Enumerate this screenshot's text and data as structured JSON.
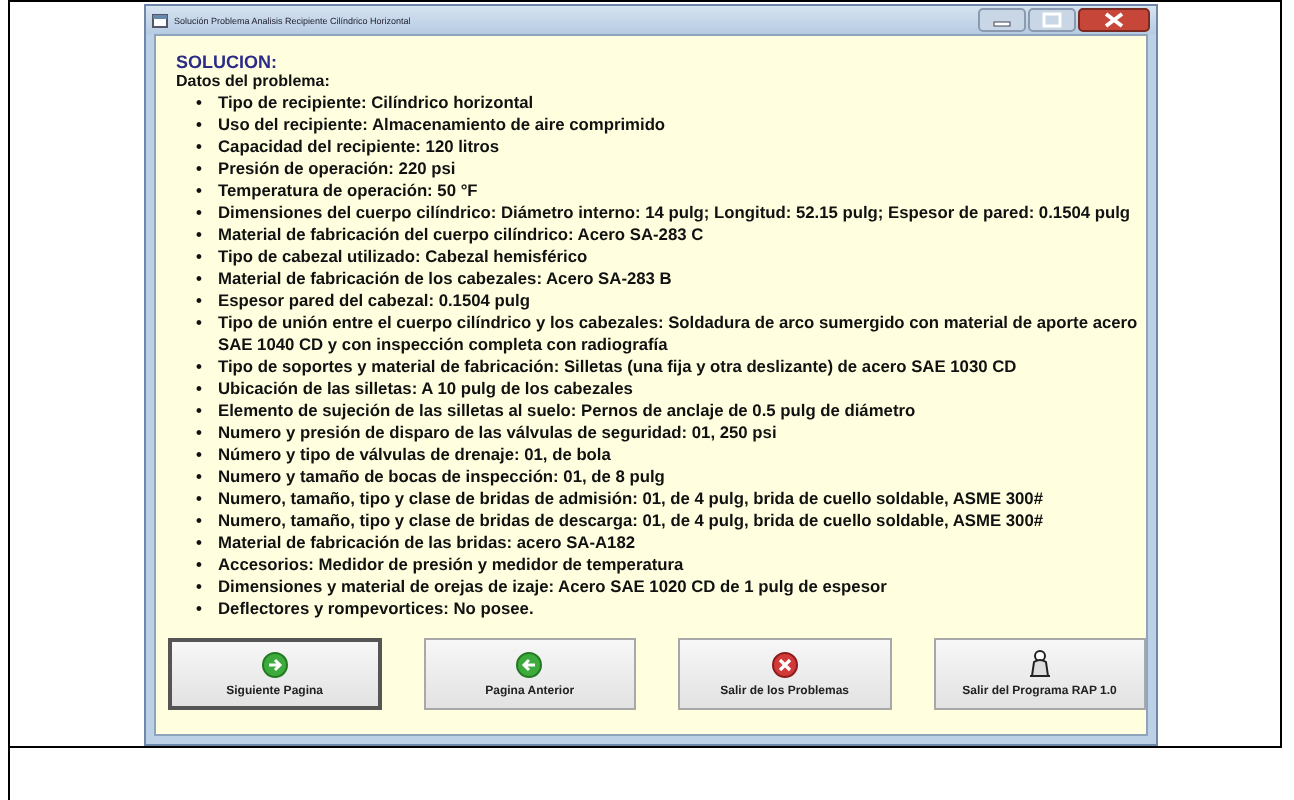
{
  "window": {
    "title": "Solución Problema Analisis Recipiente Cilíndrico Horizontal"
  },
  "heading": "SOLUCION:",
  "subheading": "Datos del problema:",
  "items": [
    {
      "bullet": "•",
      "text": "Tipo de recipiente: Cilíndrico horizontal"
    },
    {
      "bullet": "•",
      "text": "Uso del recipiente: Almacenamiento de aire comprimido"
    },
    {
      "bullet": "•",
      "text": "Capacidad del recipiente: 120 litros"
    },
    {
      "bullet": "•",
      "text": "Presión de operación: 220 psi"
    },
    {
      "bullet": "•",
      "text": "Temperatura de operación: 50 °F"
    },
    {
      "bullet": "•",
      "text": "Dimensiones del cuerpo cilíndrico: Diámetro interno: 14 pulg; Longitud: 52.15 pulg; Espesor de pared: 0.1504 pulg"
    },
    {
      "bullet": "•",
      "text": "Material de fabricación del cuerpo cilíndrico: Acero SA-283 C"
    },
    {
      "bullet": "•",
      "text": "Tipo de cabezal utilizado: Cabezal hemisférico"
    },
    {
      "bullet": "•",
      "text": "Material de fabricación de los cabezales: Acero SA-283 B"
    },
    {
      "bullet": "•",
      "text": "Espesor pared del cabezal: 0.1504 pulg"
    },
    {
      "bullet": "•",
      "text": "Tipo de unión entre el cuerpo cilíndrico y los cabezales: Soldadura de arco sumergido con material de aporte acero SAE 1040 CD y con inspección completa con radiografía"
    },
    {
      "bullet": "•",
      "text": "Tipo de soportes y material de fabricación: Silletas (una fija y otra deslizante) de acero SAE 1030 CD"
    },
    {
      "bullet": "•",
      "text": "Ubicación de las silletas: A 10 pulg de los cabezales"
    },
    {
      "bullet": "•",
      "text": "Elemento de sujeción de las silletas al suelo: Pernos de anclaje de 0.5 pulg de diámetro"
    },
    {
      "bullet": "•",
      "text": "Numero y presión de disparo de las válvulas de seguridad: 01, 250 psi"
    },
    {
      "bullet": "•",
      "text": "Número y tipo de válvulas de drenaje: 01, de bola"
    },
    {
      "bullet": "•",
      "text": "Numero y tamaño de bocas de inspección: 01, de 8 pulg"
    },
    {
      "bullet": "•",
      "text": "Numero, tamaño, tipo y clase de bridas de admisión: 01, de 4 pulg, brida de cuello soldable, ASME 300#"
    },
    {
      "bullet": "•",
      "text": "Numero, tamaño, tipo y clase de bridas de descarga: 01, de 4 pulg, brida de cuello soldable, ASME 300#"
    },
    {
      "bullet": "•",
      "text": "Material de fabricación de las bridas: acero SA-A182"
    },
    {
      "bullet": "•",
      "text": "Accesorios: Medidor de presión y medidor de temperatura"
    },
    {
      "bullet": "•",
      "text": "Dimensiones y material de orejas de izaje: Acero SAE 1020 CD de 1 pulg de espesor"
    },
    {
      "bullet": "•",
      "text": "Deflectores y rompevortices: No posee."
    }
  ],
  "buttons": [
    {
      "label": "Siguiente Pagina",
      "kind": "next",
      "focused": true
    },
    {
      "label": "Pagina Anterior",
      "kind": "back",
      "focused": false
    },
    {
      "label": "Salir de los Problemas",
      "kind": "close",
      "focused": false
    },
    {
      "label": "Salir del Programa RAP 1.0",
      "kind": "figure",
      "focused": false
    }
  ]
}
